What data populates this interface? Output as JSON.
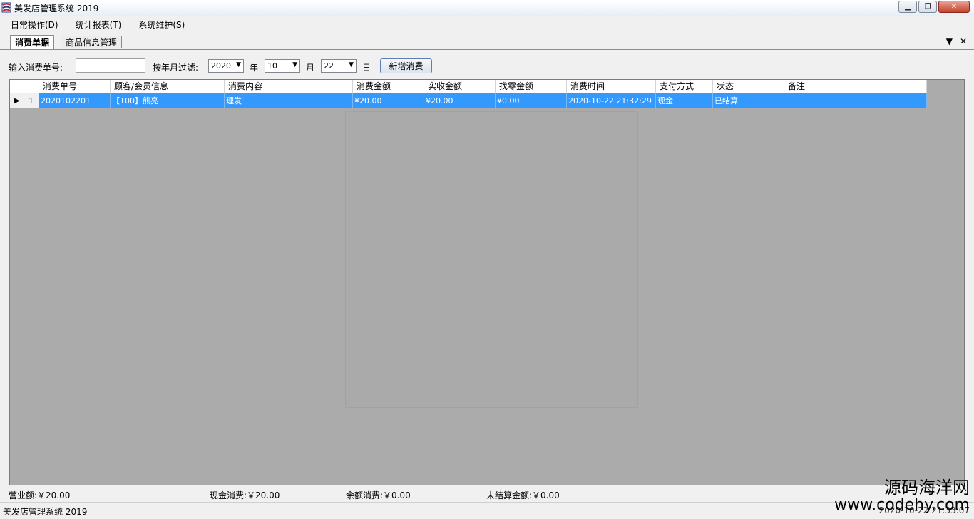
{
  "window": {
    "title": "美发店管理系统 2019"
  },
  "menu": {
    "items": [
      "日常操作(D)",
      "统计报表(T)",
      "系统维护(S)"
    ]
  },
  "tabs": [
    {
      "label": "消费单据",
      "active": true
    },
    {
      "label": "商品信息管理",
      "active": false
    }
  ],
  "tab_controls": {
    "dropdown": "▼",
    "close": "✕"
  },
  "filter": {
    "order_label": "输入消费单号:",
    "order_value": "",
    "date_label": "按年月过滤:",
    "year_value": "2020",
    "year_unit": "年",
    "month_value": "10",
    "month_unit": "月",
    "day_value": "22",
    "day_unit": "日",
    "add_button": "新增消费"
  },
  "grid": {
    "columns": [
      "消费单号",
      "顾客/会员信息",
      "消费内容",
      "消费金额",
      "实收金额",
      "找零金额",
      "消费时间",
      "支付方式",
      "状态",
      "备注"
    ],
    "rows": [
      {
        "index": "1",
        "cells": [
          "2020102201",
          "【100】熊亮",
          "理发",
          "¥20.00",
          "¥20.00",
          "¥0.00",
          "2020-10-22 21:32:29",
          "现金",
          "已结算",
          ""
        ]
      }
    ]
  },
  "summary": {
    "revenue": "营业额:￥20.00",
    "cash": "现金消费:￥20.00",
    "balance": "余额消费:￥0.00",
    "unsettled": "未结算金额:￥0.00"
  },
  "statusbar": {
    "left": "美发店管理系统 2019",
    "right": "2020-10-22 21:33:07"
  },
  "watermark": {
    "line1": "源码海洋网",
    "line2": "www.codehy.com"
  }
}
